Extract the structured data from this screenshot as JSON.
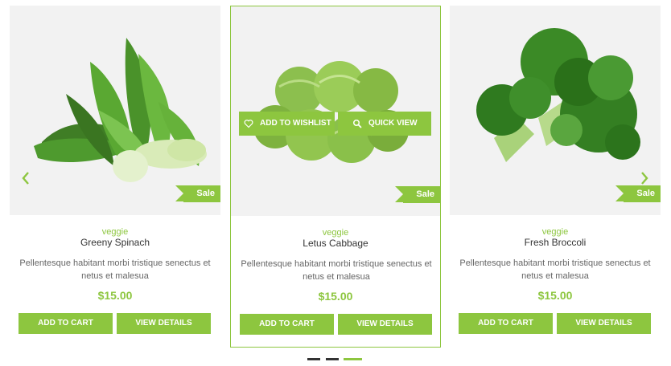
{
  "colors": {
    "accent": "#8dc63f",
    "text": "#333333",
    "muted": "#666666",
    "media_bg": "#f2f2f2"
  },
  "navigation": {
    "prev_icon": "chevron-left-icon",
    "next_icon": "chevron-right-icon"
  },
  "hover_actions": {
    "wishlist_label": "ADD TO WISHLIST",
    "wishlist_icon": "heart-icon",
    "quickview_label": "QUICK VIEW",
    "quickview_icon": "search-icon"
  },
  "products": [
    {
      "category": "veggie",
      "name": "Greeny Spinach",
      "description": "Pellentesque habitant morbi tristique senectus et netus et malesua",
      "price": "$15.00",
      "badge": "Sale",
      "image": "bok-choy-spinach",
      "add_to_cart_label": "ADD TO CART",
      "view_details_label": "VIEW DETAILS"
    },
    {
      "category": "veggie",
      "name": "Letus Cabbage",
      "description": "Pellentesque habitant morbi tristique senectus et netus et malesua",
      "price": "$15.00",
      "badge": "Sale",
      "image": "brussels-sprouts",
      "add_to_cart_label": "ADD TO CART",
      "view_details_label": "VIEW DETAILS"
    },
    {
      "category": "veggie",
      "name": "Fresh Broccoli",
      "description": "Pellentesque habitant morbi tristique senectus et netus et malesua",
      "price": "$15.00",
      "badge": "Sale",
      "image": "broccoli",
      "add_to_cart_label": "ADD TO CART",
      "view_details_label": "VIEW DETAILS"
    }
  ],
  "pagination": {
    "pages": 3,
    "active_page": 3
  }
}
